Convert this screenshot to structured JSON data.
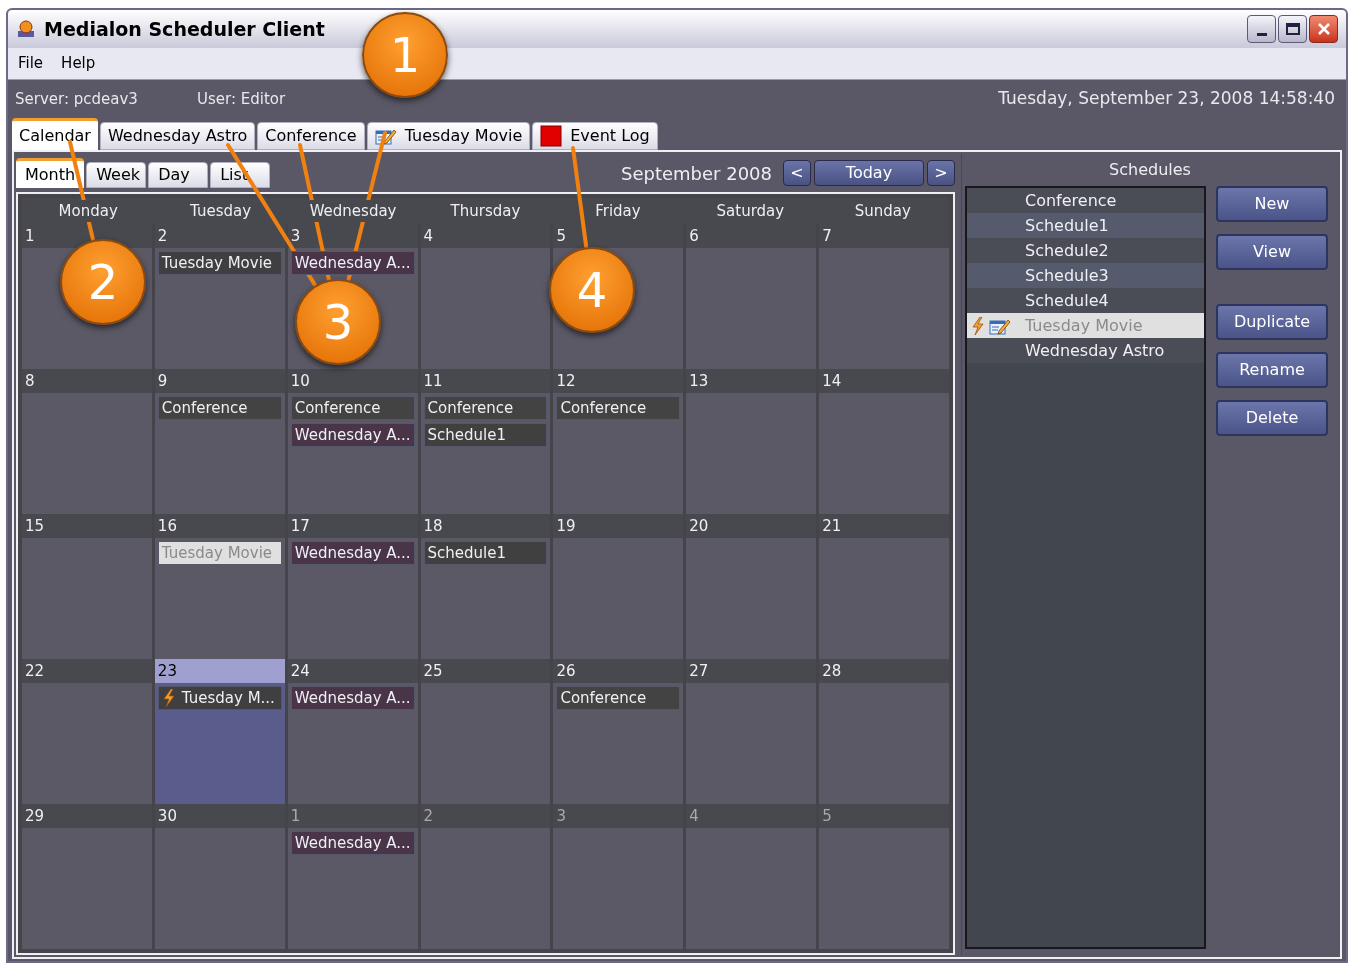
{
  "window": {
    "title": "Medialon Scheduler Client"
  },
  "menu": [
    "File",
    "Help"
  ],
  "info": {
    "server": "Server: pcdeav3",
    "user": "User: Editor",
    "datetime": "Tuesday, September 23, 2008 14:58:40"
  },
  "tabs": [
    {
      "label": "Calendar",
      "selected": true,
      "kind": "plain"
    },
    {
      "label": "Wednesday Astro",
      "selected": false,
      "kind": "plain"
    },
    {
      "label": "Conference",
      "selected": false,
      "kind": "plain"
    },
    {
      "label": "Tuesday Movie",
      "selected": false,
      "kind": "edited"
    },
    {
      "label": "Event Log",
      "selected": false,
      "kind": "log"
    }
  ],
  "calendar": {
    "view_tabs": [
      {
        "label": "Month",
        "selected": true
      },
      {
        "label": "Week",
        "selected": false
      },
      {
        "label": "Day",
        "selected": false
      },
      {
        "label": "List",
        "selected": false
      }
    ],
    "month_label": "September 2008",
    "prev": "<",
    "today": "Today",
    "next": ">",
    "weekdays": [
      "Monday",
      "Tuesday",
      "Wednesday",
      "Thursday",
      "Friday",
      "Saturday",
      "Sunday"
    ],
    "days": [
      {
        "date": "1",
        "in_month": true,
        "today": false
      },
      {
        "date": "2",
        "in_month": true,
        "today": false,
        "events": [
          {
            "label": "Tuesday Movie",
            "color": "#3f3f42",
            "selected": false,
            "running": false
          }
        ]
      },
      {
        "date": "3",
        "in_month": true,
        "today": false,
        "events": [
          {
            "label": "Wednesday A...",
            "color": "#4a3548",
            "selected": false,
            "running": false
          }
        ]
      },
      {
        "date": "4",
        "in_month": true,
        "today": false
      },
      {
        "date": "5",
        "in_month": true,
        "today": false
      },
      {
        "date": "6",
        "in_month": true,
        "today": false
      },
      {
        "date": "7",
        "in_month": true,
        "today": false
      },
      {
        "date": "8",
        "in_month": true,
        "today": false
      },
      {
        "date": "9",
        "in_month": true,
        "today": false,
        "events": [
          {
            "label": "Conference",
            "color": "#434343",
            "selected": false,
            "running": false
          }
        ]
      },
      {
        "date": "10",
        "in_month": true,
        "today": false,
        "events": [
          {
            "label": "Conference",
            "color": "#434343",
            "selected": false,
            "running": false
          },
          {
            "label": "Wednesday A...",
            "color": "#4a3548",
            "selected": false,
            "running": false
          }
        ]
      },
      {
        "date": "11",
        "in_month": true,
        "today": false,
        "events": [
          {
            "label": "Conference",
            "color": "#434343",
            "selected": false,
            "running": false
          },
          {
            "label": "Schedule1",
            "color": "#404040",
            "selected": false,
            "running": false
          }
        ]
      },
      {
        "date": "12",
        "in_month": true,
        "today": false,
        "events": [
          {
            "label": "Conference",
            "color": "#434343",
            "selected": false,
            "running": false
          }
        ]
      },
      {
        "date": "13",
        "in_month": true,
        "today": false
      },
      {
        "date": "14",
        "in_month": true,
        "today": false
      },
      {
        "date": "15",
        "in_month": true,
        "today": false
      },
      {
        "date": "16",
        "in_month": true,
        "today": false,
        "events": [
          {
            "label": "Tuesday Movie",
            "selected": true,
            "running": false
          }
        ]
      },
      {
        "date": "17",
        "in_month": true,
        "today": false,
        "events": [
          {
            "label": "Wednesday A...",
            "color": "#4a3548",
            "selected": false,
            "running": false
          }
        ]
      },
      {
        "date": "18",
        "in_month": true,
        "today": false,
        "events": [
          {
            "label": "Schedule1",
            "color": "#404040",
            "selected": false,
            "running": false
          }
        ]
      },
      {
        "date": "19",
        "in_month": true,
        "today": false
      },
      {
        "date": "20",
        "in_month": true,
        "today": false
      },
      {
        "date": "21",
        "in_month": true,
        "today": false
      },
      {
        "date": "22",
        "in_month": true,
        "today": false
      },
      {
        "date": "23",
        "in_month": true,
        "today": true,
        "events": [
          {
            "label": "Tuesday M...",
            "color": "#3f3f42",
            "selected": false,
            "running": true
          }
        ]
      },
      {
        "date": "24",
        "in_month": true,
        "today": false,
        "events": [
          {
            "label": "Wednesday A...",
            "color": "#4a3548",
            "selected": false,
            "running": false
          }
        ]
      },
      {
        "date": "25",
        "in_month": true,
        "today": false
      },
      {
        "date": "26",
        "in_month": true,
        "today": false,
        "events": [
          {
            "label": "Conference",
            "color": "#434343",
            "selected": false,
            "running": false
          }
        ]
      },
      {
        "date": "27",
        "in_month": true,
        "today": false
      },
      {
        "date": "28",
        "in_month": true,
        "today": false
      },
      {
        "date": "29",
        "in_month": true,
        "today": false
      },
      {
        "date": "30",
        "in_month": true,
        "today": false
      },
      {
        "date": "1",
        "in_month": false,
        "today": false,
        "events": [
          {
            "label": "Wednesday A...",
            "color": "#4a3548",
            "selected": false,
            "running": false
          }
        ]
      },
      {
        "date": "2",
        "in_month": false,
        "today": false
      },
      {
        "date": "3",
        "in_month": false,
        "today": false
      },
      {
        "date": "4",
        "in_month": false,
        "today": false
      },
      {
        "date": "5",
        "in_month": false,
        "today": false
      }
    ]
  },
  "schedules": {
    "title": "Schedules",
    "items": [
      {
        "label": "Conference",
        "selected": false,
        "running": false,
        "edited": false
      },
      {
        "label": "Schedule1",
        "selected": false,
        "running": false,
        "edited": false
      },
      {
        "label": "Schedule2",
        "selected": false,
        "running": false,
        "edited": false
      },
      {
        "label": "Schedule3",
        "selected": false,
        "running": false,
        "edited": false
      },
      {
        "label": "Schedule4",
        "selected": false,
        "running": false,
        "edited": false
      },
      {
        "label": "Tuesday Movie",
        "selected": true,
        "running": true,
        "edited": true
      },
      {
        "label": "Wednesday Astro",
        "selected": false,
        "running": false,
        "edited": false
      }
    ],
    "button_groups": [
      [
        "New",
        "View"
      ],
      [
        "Duplicate",
        "Rename",
        "Delete"
      ]
    ]
  },
  "callouts": [
    "1",
    "2",
    "3",
    "4"
  ]
}
